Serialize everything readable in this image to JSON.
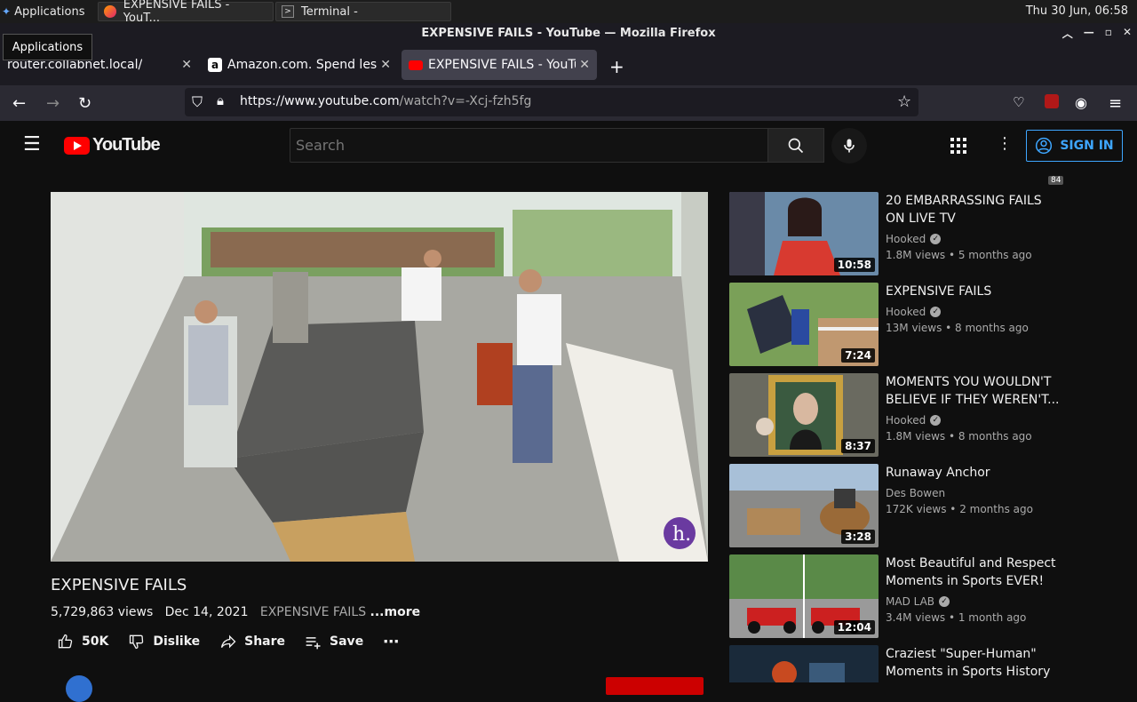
{
  "taskbar": {
    "applications_label": "Applications",
    "tasks": [
      {
        "label": "EXPENSIVE FAILS - YouT..."
      },
      {
        "label": "Terminal -"
      }
    ],
    "clock": "Thu 30 Jun, 06:58"
  },
  "tooltip": "Applications",
  "window": {
    "title": "EXPENSIVE FAILS - YouTube — Mozilla Firefox"
  },
  "tabs": [
    {
      "label": "router.collabnet.local/"
    },
    {
      "label": "Amazon.com. Spend less."
    },
    {
      "label": "EXPENSIVE FAILS - YouTube"
    }
  ],
  "urlbar": {
    "host": "https://www.youtube.com",
    "path": "/watch?v=-Xcj-fzh5fg"
  },
  "extensions": {
    "badge_count": "84"
  },
  "youtube": {
    "logo_text": "YouTube",
    "search_placeholder": "Search",
    "sign_in": "SIGN IN"
  },
  "video": {
    "title": "EXPENSIVE FAILS",
    "views": "5,729,863 views",
    "date": "Dec 14, 2021",
    "tag": "EXPENSIVE FAILS",
    "more": "...more",
    "like_count": "50K",
    "dislike": "Dislike",
    "share": "Share",
    "save": "Save"
  },
  "recommendations": [
    {
      "title": "20 EMBARRASSING FAILS ON LIVE TV",
      "channel": "Hooked",
      "verified": true,
      "views": "1.8M views",
      "age": "5 months ago",
      "duration": "10:58"
    },
    {
      "title": "EXPENSIVE FAILS",
      "channel": "Hooked",
      "verified": true,
      "views": "13M views",
      "age": "8 months ago",
      "duration": "7:24"
    },
    {
      "title": "MOMENTS YOU WOULDN'T BELIEVE IF THEY WEREN'T...",
      "channel": "Hooked",
      "verified": true,
      "views": "1.8M views",
      "age": "8 months ago",
      "duration": "8:37"
    },
    {
      "title": "Runaway Anchor",
      "channel": "Des Bowen",
      "verified": false,
      "views": "172K views",
      "age": "2 months ago",
      "duration": "3:28"
    },
    {
      "title": "Most Beautiful and Respect Moments in Sports EVER!",
      "channel": "MAD LAB",
      "verified": true,
      "views": "3.4M views",
      "age": "1 month ago",
      "duration": "12:04"
    },
    {
      "title": "Craziest \"Super-Human\" Moments in Sports History",
      "channel": "",
      "verified": false,
      "views": "",
      "age": "",
      "duration": ""
    }
  ],
  "colors": {
    "accent": "#3ea6ff",
    "brand_red": "#ff0000",
    "bg": "#0f0f0f"
  }
}
